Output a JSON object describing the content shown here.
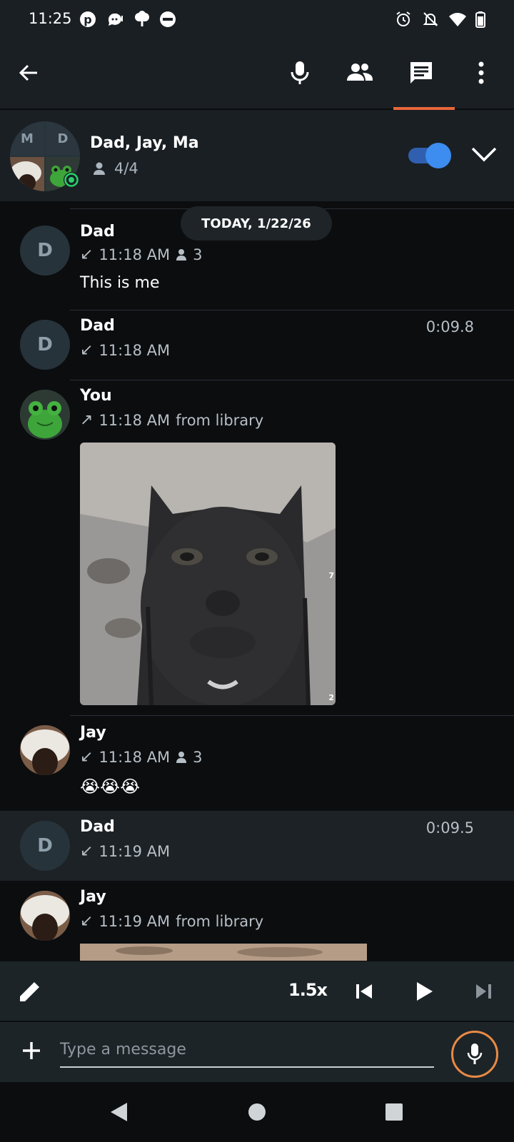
{
  "status_bar": {
    "time": "11:25",
    "icons": [
      "pinterest-icon",
      "chat-notification-icon",
      "tree-icon",
      "do-not-disturb-icon",
      "alarm-icon",
      "bell-off-icon",
      "wifi-icon",
      "battery-icon"
    ]
  },
  "app_bar": {
    "icons": [
      "back-arrow-icon",
      "microphone-icon",
      "people-icon",
      "chat-icon",
      "more-vert-icon"
    ],
    "selected_tab": "chat"
  },
  "conversation": {
    "avatar_initials": [
      "M",
      "D"
    ],
    "title": "Dad, Jay, Ma",
    "member_count": "4/4",
    "toggle_on": true
  },
  "date_chip": "TODAY, 1/22/26",
  "messages": [
    {
      "sender": "Dad",
      "initial": "D",
      "direction": "↙",
      "time": "11:18 AM",
      "listeners": "3",
      "text": "This is me"
    },
    {
      "sender": "Dad",
      "initial": "D",
      "direction": "↙",
      "time": "11:18 AM",
      "duration": "0:09.8"
    },
    {
      "sender": "You",
      "direction": "↗",
      "time": "11:18 AM",
      "source": "from library",
      "photo_overlay_top": "7",
      "photo_overlay_bottom": "2"
    },
    {
      "sender": "Jay",
      "direction": "↙",
      "time": "11:18 AM",
      "listeners": "3",
      "text": "😭😭😭"
    },
    {
      "sender": "Dad",
      "initial": "D",
      "direction": "↙",
      "time": "11:19 AM",
      "duration": "0:09.5"
    },
    {
      "sender": "Jay",
      "direction": "↙",
      "time": "11:19 AM",
      "source": "from library"
    }
  ],
  "player": {
    "speed": "1.5x"
  },
  "compose": {
    "placeholder": "Type a message",
    "value": ""
  },
  "colors": {
    "accent": "#e8673a",
    "toggle": "#3d8cf0",
    "background": "#0b0d0f",
    "surface": "#1a1f24"
  }
}
